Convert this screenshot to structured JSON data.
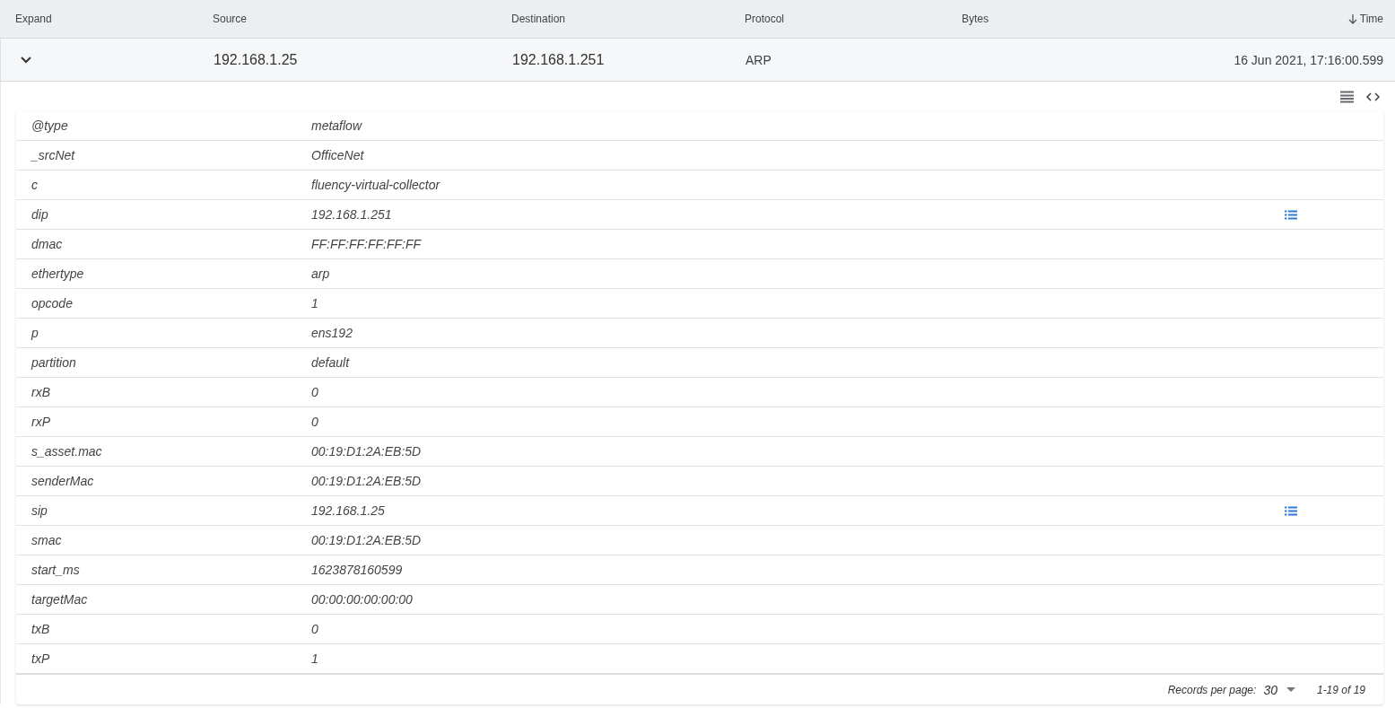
{
  "table": {
    "columns": [
      {
        "label": "Expand",
        "sorted": false
      },
      {
        "label": "Source",
        "sorted": false
      },
      {
        "label": "Destination",
        "sorted": false
      },
      {
        "label": "Protocol",
        "sorted": false
      },
      {
        "label": "Bytes",
        "sorted": false
      },
      {
        "label": "Time",
        "sorted": true
      }
    ],
    "row": {
      "expanded": true,
      "source": "192.168.1.25",
      "destination": "192.168.1.251",
      "protocol": "ARP",
      "time": "16 Jun 2021, 17:16:00.599"
    }
  },
  "details": {
    "fields": [
      {
        "key": "@type",
        "value": "metaflow",
        "list_icon": false
      },
      {
        "key": "_srcNet",
        "value": "OfficeNet",
        "list_icon": false
      },
      {
        "key": "c",
        "value": "fluency-virtual-collector",
        "list_icon": false
      },
      {
        "key": "dip",
        "value": "192.168.1.251",
        "list_icon": true
      },
      {
        "key": "dmac",
        "value": "FF:FF:FF:FF:FF:FF",
        "list_icon": false
      },
      {
        "key": "ethertype",
        "value": "arp",
        "list_icon": false
      },
      {
        "key": "opcode",
        "value": "1",
        "list_icon": false
      },
      {
        "key": "p",
        "value": "ens192",
        "list_icon": false
      },
      {
        "key": "partition",
        "value": "default",
        "list_icon": false
      },
      {
        "key": "rxB",
        "value": "0",
        "list_icon": false
      },
      {
        "key": "rxP",
        "value": "0",
        "list_icon": false
      },
      {
        "key": "s_asset.mac",
        "value": "00:19:D1:2A:EB:5D",
        "list_icon": false
      },
      {
        "key": "senderMac",
        "value": "00:19:D1:2A:EB:5D",
        "list_icon": false
      },
      {
        "key": "sip",
        "value": "192.168.1.25",
        "list_icon": true
      },
      {
        "key": "smac",
        "value": "00:19:D1:2A:EB:5D",
        "list_icon": false
      },
      {
        "key": "start_ms",
        "value": "1623878160599",
        "list_icon": false
      },
      {
        "key": "targetMac",
        "value": "00:00:00:00:00:00",
        "list_icon": false
      },
      {
        "key": "txB",
        "value": "0",
        "list_icon": false
      },
      {
        "key": "txP",
        "value": "1",
        "list_icon": false
      }
    ],
    "footer": {
      "records_label": "Records per page:",
      "records_per_page": "30",
      "range": "1-19 of 19"
    }
  }
}
